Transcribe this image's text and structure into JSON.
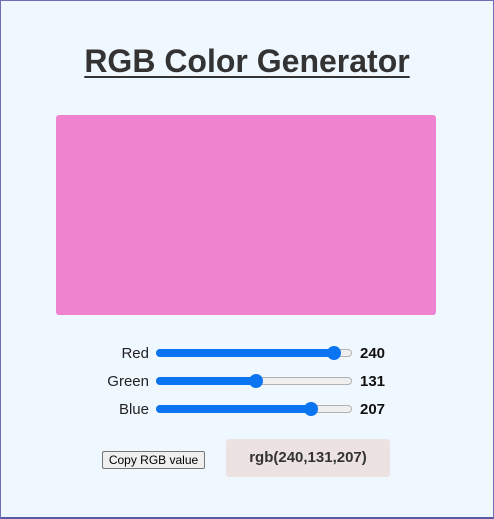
{
  "page": {
    "title": "RGB Color Generator"
  },
  "color": {
    "r": 240,
    "g": 131,
    "b": 207,
    "max": 255
  },
  "sliders": [
    {
      "label": "Red",
      "value": "240"
    },
    {
      "label": "Green",
      "value": "131"
    },
    {
      "label": "Blue",
      "value": "207"
    }
  ],
  "actions": {
    "copy_label": "Copy RGB value"
  },
  "output": {
    "rgb_text": "rgb(240,131,207)"
  },
  "colors": {
    "background": "#eff7ff",
    "accent": "#0b74f0",
    "swatch": "#f083cf",
    "output_bg": "#ece2e1",
    "title": "#333333"
  }
}
